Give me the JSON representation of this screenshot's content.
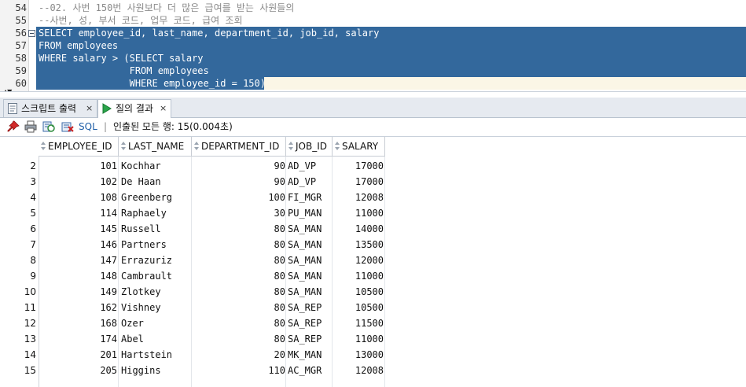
{
  "editor": {
    "lines": [
      {
        "num": "54",
        "text": "--02. 사번 150번 사원보다 더 많은 급여를 받는 사원들의",
        "selected": false
      },
      {
        "num": "55",
        "text": "--사번, 성, 부서 코드, 업무 코드, 급여 조회",
        "selected": false
      },
      {
        "num": "56",
        "text": "SELECT employee_id, last_name, department_id, job_id, salary",
        "selected": true
      },
      {
        "num": "57",
        "text": "FROM employees",
        "selected": true
      },
      {
        "num": "58",
        "text": "WHERE salary > (SELECT salary",
        "selected": true
      },
      {
        "num": "59",
        "text": "                FROM employees",
        "selected": true
      },
      {
        "num": "60",
        "text": "                WHERE employee_id = 150);",
        "selected": true
      }
    ]
  },
  "tabs": [
    {
      "label": "스크립트 출력",
      "close": "×",
      "active": false
    },
    {
      "label": "질의 결과",
      "close": "×",
      "active": true
    }
  ],
  "toolbar": {
    "sql_label": "SQL",
    "separator": "|",
    "status": "인출된 모든 행: 15(0.004초)"
  },
  "colors": {
    "selection": "#33689c",
    "sql_label": "#1f5fa8"
  },
  "icons": [
    "pin-icon",
    "print-icon",
    "refresh-icon",
    "export-icon",
    "script-output-icon",
    "run-query-icon"
  ],
  "grid": {
    "columns": [
      "EMPLOYEE_ID",
      "LAST_NAME",
      "DEPARTMENT_ID",
      "JOB_ID",
      "SALARY"
    ],
    "rows": [
      {
        "rownum": "2",
        "employee_id": "101",
        "last_name": "Kochhar",
        "department_id": "90",
        "job_id": "AD_VP",
        "salary": "17000"
      },
      {
        "rownum": "3",
        "employee_id": "102",
        "last_name": "De Haan",
        "department_id": "90",
        "job_id": "AD_VP",
        "salary": "17000"
      },
      {
        "rownum": "4",
        "employee_id": "108",
        "last_name": "Greenberg",
        "department_id": "100",
        "job_id": "FI_MGR",
        "salary": "12008"
      },
      {
        "rownum": "5",
        "employee_id": "114",
        "last_name": "Raphaely",
        "department_id": "30",
        "job_id": "PU_MAN",
        "salary": "11000"
      },
      {
        "rownum": "6",
        "employee_id": "145",
        "last_name": "Russell",
        "department_id": "80",
        "job_id": "SA_MAN",
        "salary": "14000"
      },
      {
        "rownum": "7",
        "employee_id": "146",
        "last_name": "Partners",
        "department_id": "80",
        "job_id": "SA_MAN",
        "salary": "13500"
      },
      {
        "rownum": "8",
        "employee_id": "147",
        "last_name": "Errazuriz",
        "department_id": "80",
        "job_id": "SA_MAN",
        "salary": "12000"
      },
      {
        "rownum": "9",
        "employee_id": "148",
        "last_name": "Cambrault",
        "department_id": "80",
        "job_id": "SA_MAN",
        "salary": "11000"
      },
      {
        "rownum": "10",
        "employee_id": "149",
        "last_name": "Zlotkey",
        "department_id": "80",
        "job_id": "SA_MAN",
        "salary": "10500"
      },
      {
        "rownum": "11",
        "employee_id": "162",
        "last_name": "Vishney",
        "department_id": "80",
        "job_id": "SA_REP",
        "salary": "10500"
      },
      {
        "rownum": "12",
        "employee_id": "168",
        "last_name": "Ozer",
        "department_id": "80",
        "job_id": "SA_REP",
        "salary": "11500"
      },
      {
        "rownum": "13",
        "employee_id": "174",
        "last_name": "Abel",
        "department_id": "80",
        "job_id": "SA_REP",
        "salary": "11000"
      },
      {
        "rownum": "14",
        "employee_id": "201",
        "last_name": "Hartstein",
        "department_id": "20",
        "job_id": "MK_MAN",
        "salary": "13000"
      },
      {
        "rownum": "15",
        "employee_id": "205",
        "last_name": "Higgins",
        "department_id": "110",
        "job_id": "AC_MGR",
        "salary": "12008"
      }
    ]
  }
}
